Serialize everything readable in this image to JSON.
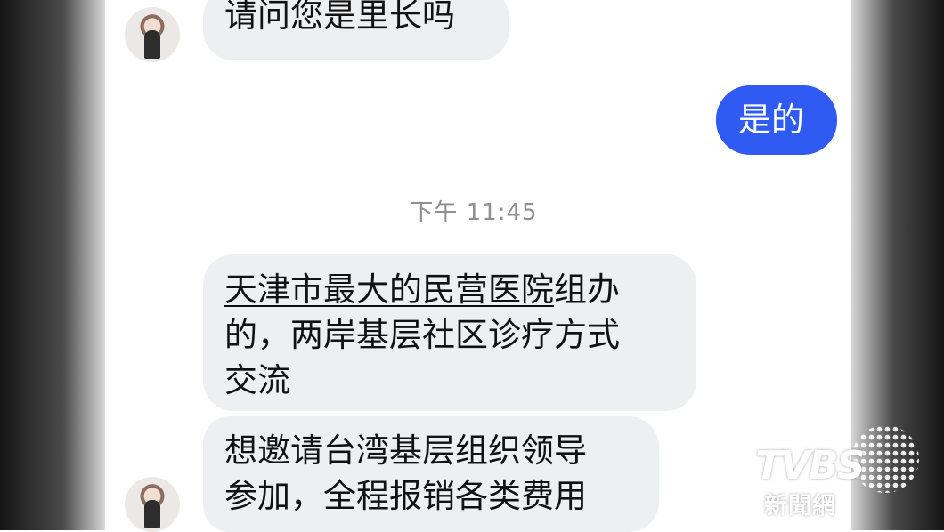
{
  "messages": [
    {
      "direction": "incoming",
      "text": "请问您是里长吗"
    },
    {
      "direction": "outgoing",
      "text": "是的"
    },
    {
      "direction": "incoming",
      "line1_underlined": "天津市最大的民营医院",
      "line1_rest": "组办",
      "line2": "的，两岸基层社区诊疗方式",
      "line3": "交流"
    },
    {
      "direction": "incoming",
      "line1": "想邀请台湾基层组织领导",
      "line2": "参加，全程报销各类费用"
    }
  ],
  "timestamp": "下午 11:45",
  "watermark": {
    "brand": "TVBS",
    "subtitle": "新聞網"
  },
  "colors": {
    "outgoing_bubble": "#2f5bf3",
    "incoming_bubble": "#eeeff1",
    "timestamp": "#8e8e93"
  }
}
